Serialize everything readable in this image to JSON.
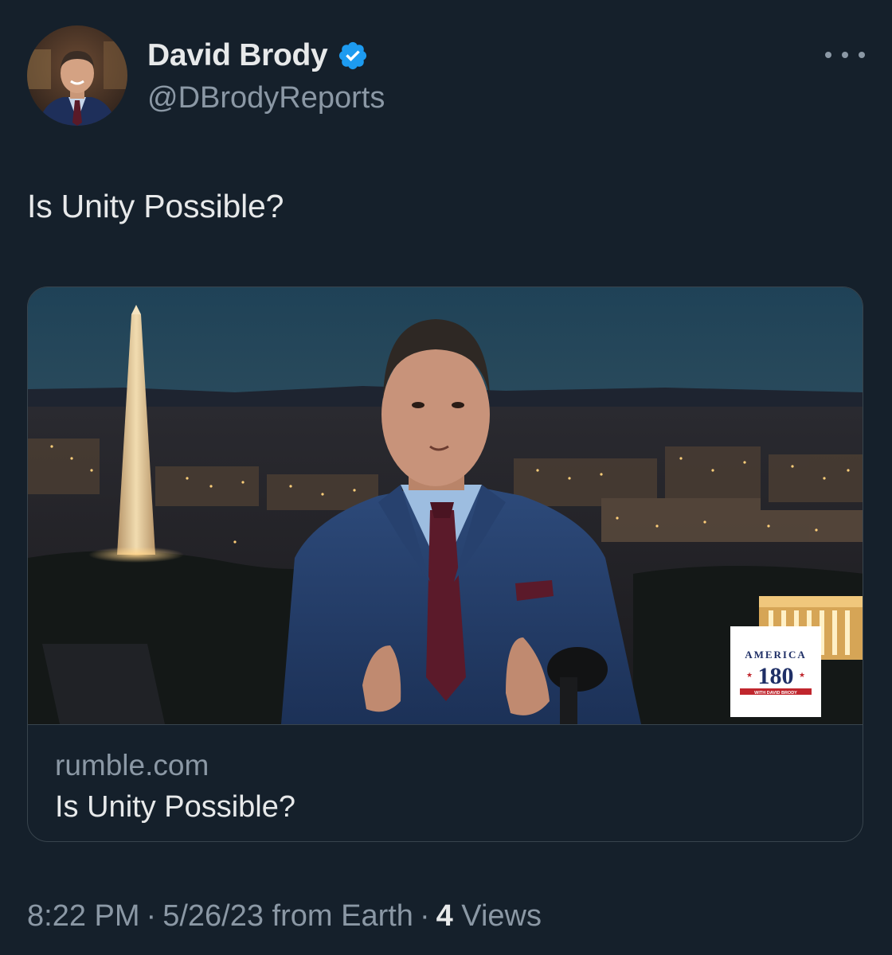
{
  "author": {
    "name": "David Brody",
    "handle": "@DBrodyReports",
    "verified": true
  },
  "tweet": {
    "text": "Is Unity Possible?"
  },
  "card": {
    "domain": "rumble.com",
    "title": "Is Unity Possible?",
    "logo": {
      "top_arc": "AMERICA",
      "number": "180",
      "bottom": "WITH DAVID BRODY"
    }
  },
  "meta": {
    "time": "8:22 PM",
    "date": "5/26/23",
    "source": "from Earth",
    "separator": "·",
    "views_count": "4",
    "views_label": "Views"
  },
  "colors": {
    "background": "#15202b",
    "primary_text": "#e7e9ea",
    "secondary_text": "#8b98a5",
    "border": "#38444d",
    "verified_blue": "#1d9bf0"
  },
  "icons": {
    "verified": "verified-badge-icon",
    "more": "more-options-icon"
  }
}
